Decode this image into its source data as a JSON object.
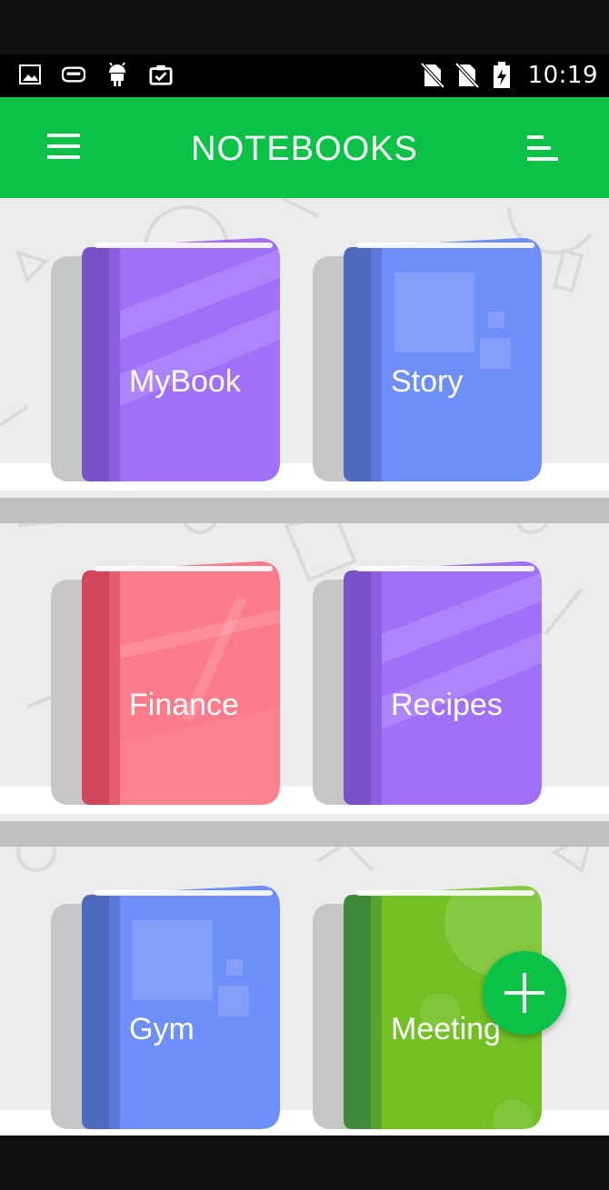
{
  "status_bar": {
    "time": "10:19",
    "left_icons": [
      "image-icon",
      "game-controller-icon",
      "android-icon",
      "clipboard-check-icon"
    ],
    "right_icons": [
      "no-sim-icon",
      "no-sim-icon",
      "battery-charging-icon"
    ]
  },
  "app_bar": {
    "title": "NOTEBOOKS",
    "menu_icon": "hamburger-menu-icon",
    "sort_icon": "sort-icon",
    "color": "#0AC246"
  },
  "notebooks": [
    {
      "label": "MyBook",
      "color": "#A070F8",
      "spine": "#7A52C8",
      "style": "stripes"
    },
    {
      "label": "Story",
      "color": "#6E8EF8",
      "spine": "#4F68C0",
      "style": "squares"
    },
    {
      "label": "Finance",
      "color": "#FC7B8A",
      "spine": "#D2465A",
      "style": "lines"
    },
    {
      "label": "Recipes",
      "color": "#A070F8",
      "spine": "#7A52C8",
      "style": "stripes"
    },
    {
      "label": "Gym",
      "color": "#6E8EF8",
      "spine": "#4F68C0",
      "style": "squares"
    },
    {
      "label": "Meeting",
      "color": "#72C024",
      "spine": "#3F8A3A",
      "style": "circles"
    }
  ],
  "fab": {
    "icon": "plus-icon"
  }
}
